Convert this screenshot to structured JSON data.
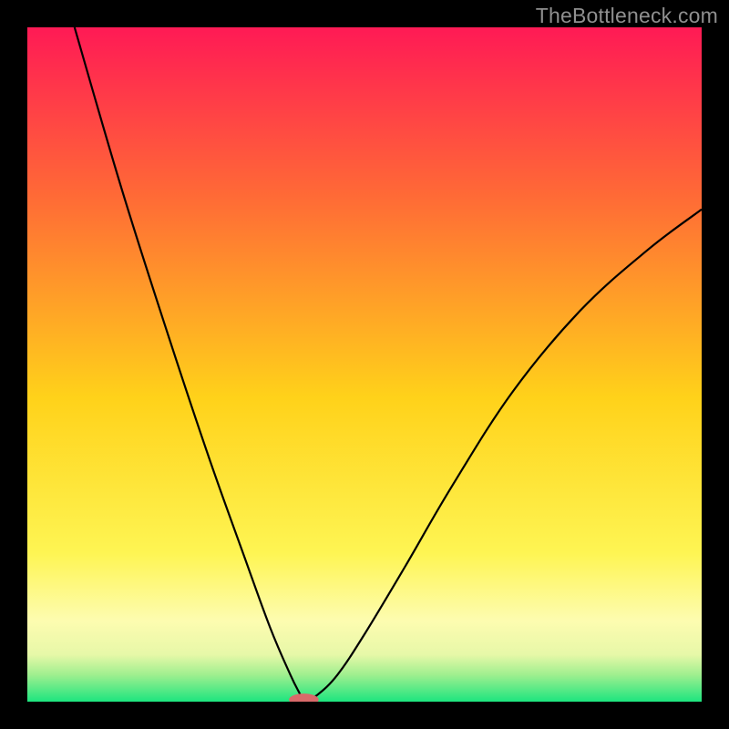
{
  "watermark": "TheBottleneck.com",
  "chart_data": {
    "type": "line",
    "title": "",
    "xlabel": "",
    "ylabel": "",
    "xlim": [
      0,
      100
    ],
    "ylim": [
      0,
      100
    ],
    "x_min_point": 41,
    "series": [
      {
        "name": "left-branch",
        "x": [
          7,
          14,
          21,
          27,
          32,
          36,
          39,
          40.5,
          41
        ],
        "y": [
          100,
          76,
          54,
          36,
          22,
          11,
          4,
          1,
          0
        ]
      },
      {
        "name": "right-branch",
        "x": [
          41,
          43,
          46,
          50,
          56,
          63,
          72,
          82,
          92,
          100
        ],
        "y": [
          0,
          1,
          4,
          10,
          20,
          32,
          46,
          58,
          67,
          73
        ]
      }
    ],
    "gradient_stops": [
      {
        "offset": 0,
        "color": "#ff1a55"
      },
      {
        "offset": 25,
        "color": "#ff6a36"
      },
      {
        "offset": 55,
        "color": "#ffd21a"
      },
      {
        "offset": 78,
        "color": "#fef553"
      },
      {
        "offset": 88,
        "color": "#fdfcb0"
      },
      {
        "offset": 93,
        "color": "#e7f8a8"
      },
      {
        "offset": 96,
        "color": "#a0ef8f"
      },
      {
        "offset": 100,
        "color": "#1de57f"
      }
    ],
    "marker": {
      "x": 41,
      "y": 0.3,
      "rx": 2.2,
      "ry": 0.9,
      "color": "#d96a6a"
    }
  }
}
